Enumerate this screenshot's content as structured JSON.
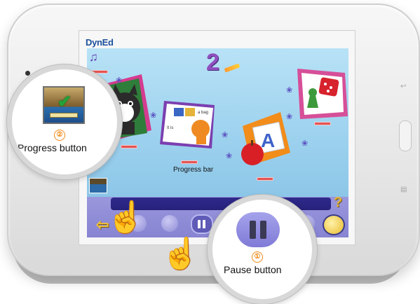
{
  "app": {
    "logo": "DynEd",
    "level_number": "2",
    "progress_bar_caption": "Progress bar",
    "help_glyph": "?"
  },
  "icons": {
    "music": "music-note-icon",
    "back": "back-arrow-icon",
    "pause": "pause-icon",
    "record": "record-icon",
    "help": "help-icon",
    "progress": "progress-check-icon",
    "paw": "paw-print-icon",
    "hand": "pointing-hand-icon"
  },
  "callouts": {
    "progress": {
      "number": "②",
      "label": "Progress button"
    },
    "pause": {
      "number": "①",
      "label": "Pause button"
    }
  },
  "lesson_cards": [
    {
      "id": "cat",
      "subject": "cat"
    },
    {
      "id": "book",
      "subject": "book",
      "text_a": "It is",
      "text_b": "a bag"
    },
    {
      "id": "alphabet",
      "subject": "apple and letter block",
      "letter": "A"
    },
    {
      "id": "game",
      "subject": "dice and game piece"
    }
  ],
  "colors": {
    "app_background": "#a8dcf3",
    "control_bar": "#8e8bd6",
    "track": "#2a2582",
    "accent_orange": "#f08a17",
    "progress_strip": "#e35454"
  }
}
